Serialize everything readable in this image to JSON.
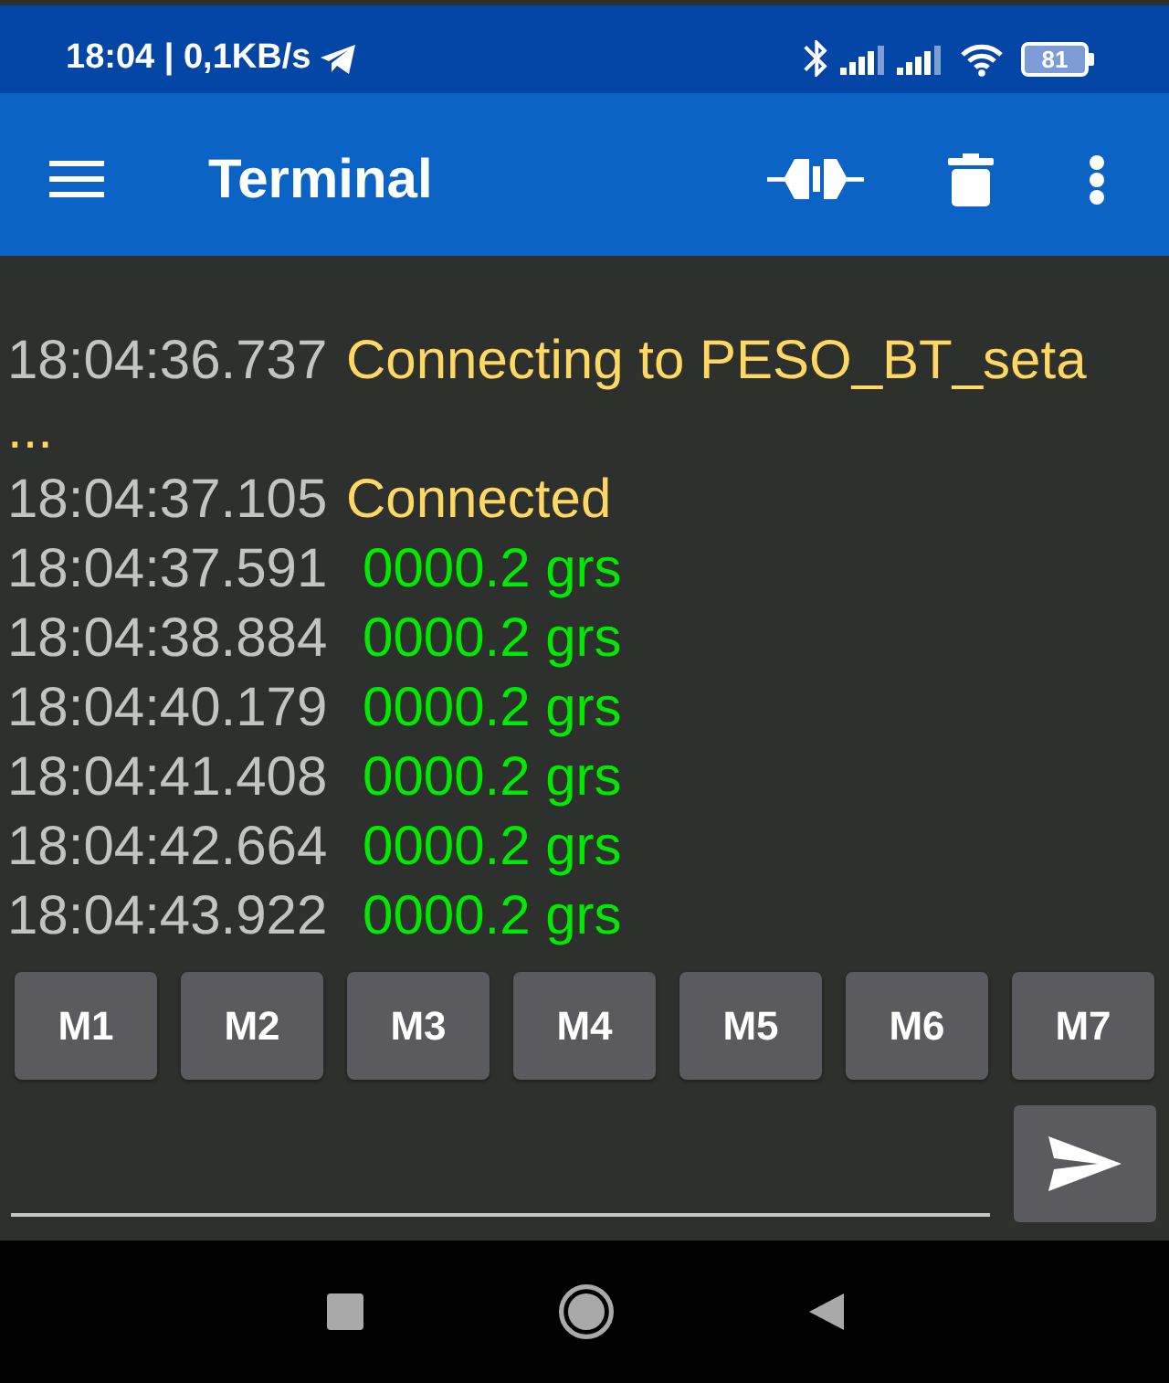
{
  "status_bar": {
    "time_and_speed": "18:04 | 0,1KB/s",
    "battery": "81"
  },
  "app_bar": {
    "title": "Terminal"
  },
  "terminal": {
    "lines": [
      {
        "kind": "status",
        "timestamp": "18:04:36.737",
        "message": "Connecting to PESO_BT_seta ..."
      },
      {
        "kind": "status",
        "timestamp": "18:04:37.105",
        "message": "Connected"
      },
      {
        "kind": "data",
        "timestamp": "18:04:37.591",
        "message": "0000.2 grs"
      },
      {
        "kind": "data",
        "timestamp": "18:04:38.884",
        "message": "0000.2 grs"
      },
      {
        "kind": "data",
        "timestamp": "18:04:40.179",
        "message": "0000.2 grs"
      },
      {
        "kind": "data",
        "timestamp": "18:04:41.408",
        "message": "0000.2 grs"
      },
      {
        "kind": "data",
        "timestamp": "18:04:42.664",
        "message": "0000.2 grs"
      },
      {
        "kind": "data",
        "timestamp": "18:04:43.922",
        "message": "0000.2 grs"
      }
    ]
  },
  "macro_buttons": [
    "M1",
    "M2",
    "M3",
    "M4",
    "M5",
    "M6",
    "M7"
  ]
}
